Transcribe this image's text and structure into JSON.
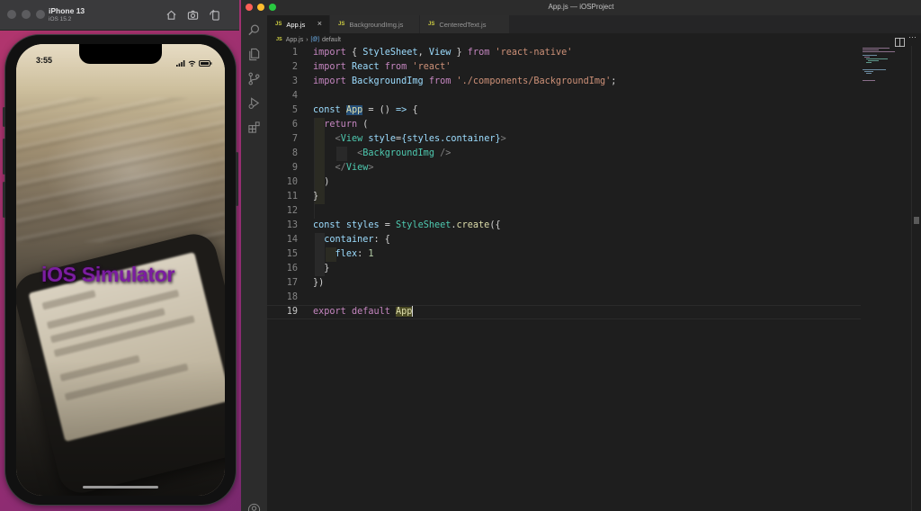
{
  "simulator": {
    "device_name": "iPhone 13",
    "os_version": "iOS 15.2",
    "toolbar_icons": [
      "home-icon",
      "screenshot-icon",
      "rotate-icon"
    ],
    "status_time": "3:55",
    "status_icons": [
      "signal-icon",
      "wifi-icon",
      "battery-icon"
    ],
    "app_text": "iOS Simulator",
    "app_text_color": "#7b1da0"
  },
  "vscode": {
    "window_title": "App.js — iOSProject",
    "tabs": [
      {
        "label": "App.js",
        "badge": "JS",
        "active": true
      },
      {
        "label": "BackgroundImg.js",
        "badge": "JS",
        "active": false
      },
      {
        "label": "CenteredText.js",
        "badge": "JS",
        "active": false
      }
    ],
    "breadcrumb": {
      "file": "App.js",
      "badge": "JS",
      "symbol_icon": "symbol-variable-icon",
      "symbol": "default"
    },
    "activity_icons": [
      "search-icon",
      "explorer-icon",
      "source-control-icon",
      "run-debug-icon",
      "extensions-icon",
      "account-icon"
    ],
    "current_line": 19,
    "lines": [
      "import { StyleSheet, View } from 'react-native'",
      "import React from 'react'",
      "import BackgroundImg from './components/BackgroundImg';",
      "",
      "const App = () => {",
      "  return (",
      "    <View style={styles.container}>",
      "        <BackgroundImg />",
      "    </View>",
      "  )",
      "}",
      "",
      "const styles = StyleSheet.create({",
      "  container: {",
      "    flex: 1",
      "  }",
      "})",
      "",
      "export default App"
    ],
    "colors": {
      "background": "#1e1e1e",
      "keyword": "#c586c0",
      "string": "#ce9178",
      "variable": "#9cdcfe",
      "class": "#4ec9b0",
      "selection": "#264f78"
    }
  }
}
